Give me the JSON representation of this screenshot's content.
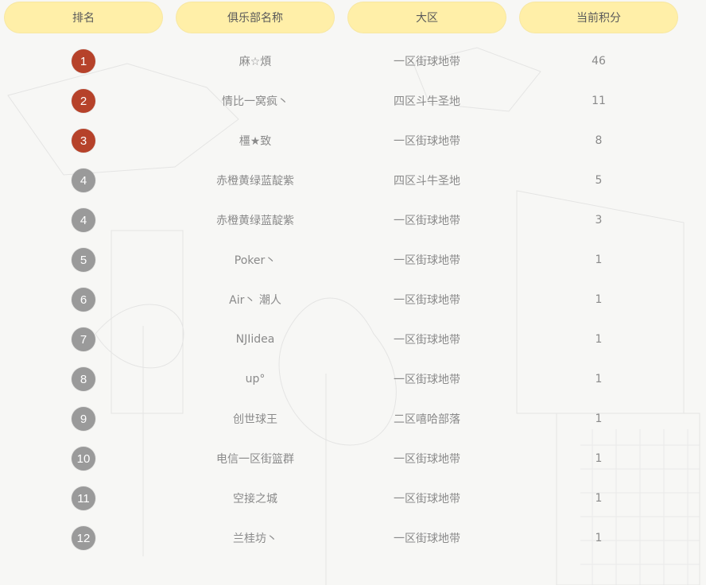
{
  "colors": {
    "header_bg": "#ffefa8",
    "rank_top": "#b6422a",
    "rank_other": "#9a9a9a",
    "text": "#8a8a8a"
  },
  "header": {
    "rank": "排名",
    "club": "俱乐部名称",
    "area": "大区",
    "score": "当前积分"
  },
  "rows": [
    {
      "rank": "1",
      "club": "麻☆煩",
      "area": "一区街球地带",
      "score": "46",
      "top": true
    },
    {
      "rank": "2",
      "club": "情比一窝疯丶",
      "area": "四区斗牛圣地",
      "score": "11",
      "top": true
    },
    {
      "rank": "3",
      "club": "橿★致",
      "area": "一区街球地带",
      "score": "8",
      "top": true
    },
    {
      "rank": "4",
      "club": "赤橙黄绿蓝靛紫",
      "area": "四区斗牛圣地",
      "score": "5",
      "top": false
    },
    {
      "rank": "4",
      "club": "赤橙黄绿蓝靛紫",
      "area": "一区街球地带",
      "score": "3",
      "top": false
    },
    {
      "rank": "5",
      "club": "Poker丶",
      "area": "一区街球地带",
      "score": "1",
      "top": false
    },
    {
      "rank": "6",
      "club": "Air丶 潮人",
      "area": "一区街球地带",
      "score": "1",
      "top": false
    },
    {
      "rank": "7",
      "club": "NJIidea",
      "area": "一区街球地带",
      "score": "1",
      "top": false
    },
    {
      "rank": "8",
      "club": "up°",
      "area": "一区街球地带",
      "score": "1",
      "top": false
    },
    {
      "rank": "9",
      "club": "创世球王",
      "area": "二区嘻哈部落",
      "score": "1",
      "top": false
    },
    {
      "rank": "10",
      "club": "电信一区街篮群",
      "area": "一区街球地带",
      "score": "1",
      "top": false
    },
    {
      "rank": "11",
      "club": "空接之城",
      "area": "一区街球地带",
      "score": "1",
      "top": false
    },
    {
      "rank": "12",
      "club": "兰桂坊丶",
      "area": "一区街球地带",
      "score": "1",
      "top": false
    }
  ]
}
